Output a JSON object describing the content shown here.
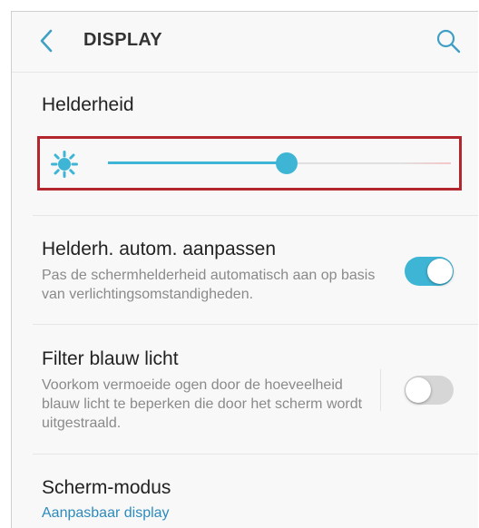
{
  "header": {
    "title": "DISPLAY",
    "back_icon": "chevron-left-icon",
    "search_icon": "search-icon",
    "accent": "#3fb5d6"
  },
  "brightness": {
    "label": "Helderheid",
    "icon": "brightness-sun-icon",
    "level_percent": 52,
    "highlight_color": "#b3262d"
  },
  "settings": [
    {
      "title": "Helderh. autom. aanpassen",
      "subtitle": "Pas de schermhelderheid automatisch aan op basis van verlichtingsomstandigheden.",
      "toggle": "on"
    },
    {
      "title": "Filter blauw licht",
      "subtitle": "Voorkom vermoeide ogen door de hoeveelheid blauw licht te beperken die door het scherm wordt uitgestraald.",
      "toggle": "off"
    },
    {
      "title": "Scherm-modus",
      "value": "Aanpasbaar display"
    }
  ]
}
